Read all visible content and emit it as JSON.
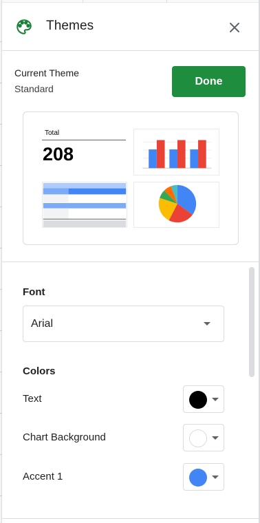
{
  "panel": {
    "title": "Themes",
    "icon": "palette-icon",
    "close_icon": "close-icon"
  },
  "current_theme": {
    "label": "Current Theme",
    "value": "Standard"
  },
  "done_button": {
    "label": "Done",
    "color": "#1e8e3e"
  },
  "preview": {
    "scorecard": {
      "title": "Total",
      "value": "208"
    },
    "bar_colors": [
      "#4285f4",
      "#ea4335"
    ],
    "pie_colors": [
      "#4285f4",
      "#ea4335",
      "#fbbc04",
      "#34a853",
      "#ff6d01",
      "#46bdc6"
    ]
  },
  "font_section": {
    "heading": "Font",
    "selected": "Arial",
    "dropdown_icon": "arrow-drop-down-icon"
  },
  "colors_section": {
    "heading": "Colors",
    "rows": [
      {
        "label": "Text",
        "color": "#000000"
      },
      {
        "label": "Chart Background",
        "color": "#ffffff"
      },
      {
        "label": "Accent 1",
        "color": "#4285f4"
      }
    ]
  }
}
